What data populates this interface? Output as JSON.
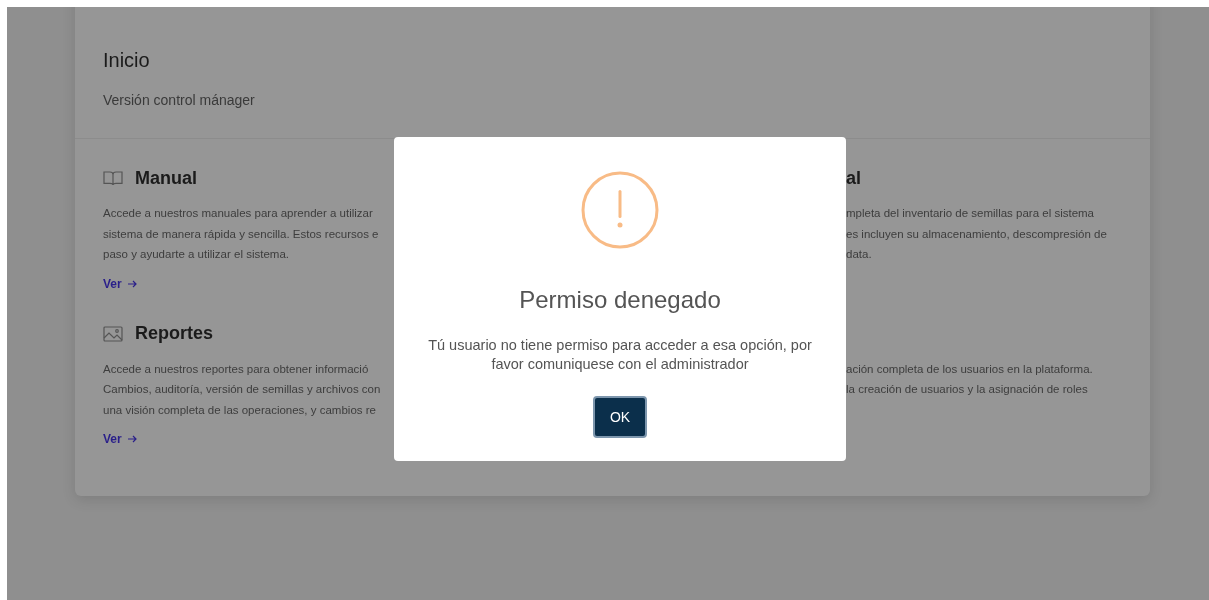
{
  "header": {
    "title": "Inicio",
    "subtitle": "Versión control mánager"
  },
  "rows": [
    {
      "left": {
        "title": "Manual",
        "lines": [
          "Accede a nuestros manuales para aprender a utilizar",
          "sistema de manera rápida y sencilla. Estos recursos e",
          "paso y ayudarte a utilizar el sistema."
        ],
        "link": "Ver"
      },
      "right": {
        "title": "al",
        "lines": [
          "mpleta del inventario de semillas para el sistema",
          "es incluyen su almacenamiento, descompresión de",
          "data."
        ]
      }
    },
    {
      "left": {
        "title": "Reportes",
        "lines": [
          "Accede a nuestros reportes para obtener informació",
          "Cambios, auditoría, versión de semillas y archivos con",
          "una visión completa de las operaciones, y cambios re"
        ],
        "link": "Ver"
      },
      "right": {
        "lines": [
          "ación completa de los usuarios en la plataforma.",
          "la creación de usuarios y la asignación de roles"
        ]
      }
    }
  ],
  "dialog": {
    "title": "Permiso denegado",
    "message": "Tú usuario no tiene permiso para acceder a esa opción, por favor comuniquese con el administrador",
    "button": "OK"
  }
}
